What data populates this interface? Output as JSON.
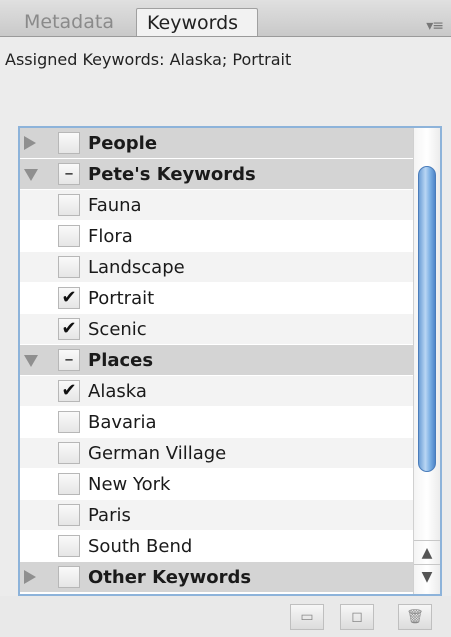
{
  "tabs": [
    {
      "label": "Metadata"
    },
    {
      "label": "Keywords"
    }
  ],
  "panel_menu_icon": "panel-menu-icon",
  "assigned_text": "Assigned Keywords: Alaska; Portrait",
  "rows": [
    {
      "kind": "group",
      "expanded": false,
      "check": "",
      "label": "People"
    },
    {
      "kind": "group",
      "expanded": true,
      "check": "–",
      "label": "Pete's Keywords"
    },
    {
      "kind": "child",
      "check": "",
      "label": "Fauna"
    },
    {
      "kind": "child",
      "check": "",
      "label": "Flora"
    },
    {
      "kind": "child",
      "check": "",
      "label": "Landscape"
    },
    {
      "kind": "child",
      "check": "✔",
      "label": "Portrait"
    },
    {
      "kind": "child",
      "check": "✔",
      "label": "Scenic"
    },
    {
      "kind": "group",
      "expanded": true,
      "check": "–",
      "label": "Places"
    },
    {
      "kind": "child",
      "check": "✔",
      "label": "Alaska"
    },
    {
      "kind": "child",
      "check": "",
      "label": "Bavaria"
    },
    {
      "kind": "child",
      "check": "",
      "label": "German Village"
    },
    {
      "kind": "child",
      "check": "",
      "label": "New York"
    },
    {
      "kind": "child",
      "check": "",
      "label": "Paris"
    },
    {
      "kind": "child",
      "check": "",
      "label": "South Bend"
    },
    {
      "kind": "group",
      "expanded": false,
      "check": "",
      "label": "Other Keywords"
    }
  ],
  "scroll_arrows": {
    "up": "▲",
    "down": "▼"
  },
  "toolbar": {
    "new_set_icon": "▭",
    "new_keyword_icon": "◻",
    "delete_icon": "🗑"
  },
  "colors": {
    "accent": "#8db3da",
    "group_bg": "#d4d4d4",
    "thumb": "#6d9fd6"
  }
}
